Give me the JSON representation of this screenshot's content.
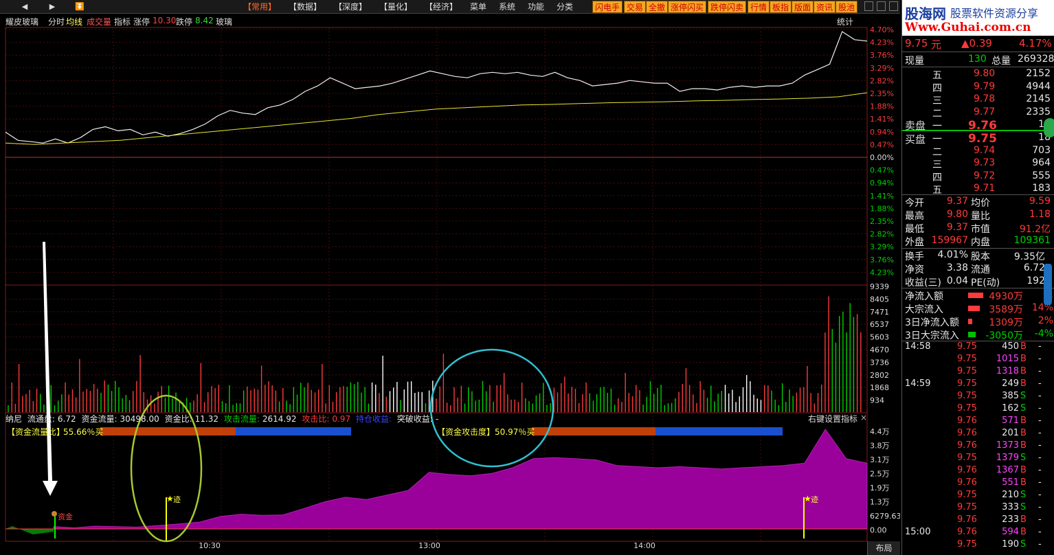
{
  "toolbar": {
    "nav": [
      "◀",
      "▶",
      "⏬"
    ],
    "menus": [
      "【常用】",
      "【数据】",
      "【深度】",
      "【量化】",
      "【经济】",
      "菜单",
      "系统",
      "功能",
      "分类"
    ],
    "active_menu": 0,
    "quick_buttons": [
      "闪电手",
      "交易",
      "全撤",
      "涨停闪买",
      "跌停闪卖",
      "行情",
      "板指",
      "版面",
      "资讯",
      "股池"
    ]
  },
  "title_row": {
    "stock_name": "耀皮玻璃",
    "view": "分时",
    "avg_line": "均线",
    "volume": "成交量",
    "indicator": "指标",
    "limit_up_label": "涨停",
    "limit_up": "10.30",
    "limit_down_label": "跌停",
    "limit_down": "8.42",
    "sector": "玻璃",
    "stats": "统计"
  },
  "chart_data": {
    "type": "line",
    "price_axis_pct": [
      "4.70%",
      "4.23%",
      "3.76%",
      "3.29%",
      "2.82%",
      "2.35%",
      "1.88%",
      "1.41%",
      "0.94%",
      "0.47%",
      "0.00%",
      "0.47%",
      "0.94%",
      "1.41%",
      "1.88%",
      "2.35%",
      "2.82%",
      "3.29%",
      "3.76%",
      "4.23%"
    ],
    "volume_axis": [
      "9339",
      "8405",
      "7471",
      "6537",
      "5603",
      "4670",
      "3736",
      "2802",
      "1868",
      "934"
    ],
    "fund_axis": [
      "4.4万",
      "3.8万",
      "3.1万",
      "2.5万",
      "1.9万",
      "1.3万",
      "6279.63",
      "0.00"
    ],
    "time_labels": [
      "10:30",
      "13:00",
      "14:00"
    ],
    "price_pct_series": [
      0.9,
      0.6,
      0.55,
      0.5,
      0.65,
      0.5,
      0.7,
      1.0,
      1.1,
      0.95,
      1.0,
      0.8,
      0.9,
      0.75,
      0.85,
      1.0,
      1.2,
      1.5,
      1.7,
      1.6,
      1.55,
      1.8,
      1.9,
      2.1,
      2.4,
      2.6,
      2.9,
      2.7,
      2.5,
      2.55,
      2.6,
      2.7,
      2.85,
      3.0,
      3.15,
      3.05,
      2.95,
      2.9,
      3.05,
      3.1,
      3.05,
      3.1,
      3.0,
      2.95,
      3.1,
      2.9,
      2.8,
      2.6,
      2.65,
      2.7,
      2.8,
      2.75,
      2.7,
      2.7,
      2.4,
      2.5,
      2.5,
      2.45,
      2.55,
      2.6,
      2.55,
      2.6,
      2.6,
      2.7,
      3.0,
      3.2,
      3.4,
      4.6,
      4.3,
      4.25
    ],
    "avg_pct_series": [
      0.5,
      0.45,
      0.5,
      0.55,
      0.6,
      0.7,
      0.8,
      0.9,
      1.0,
      1.1,
      1.2,
      1.3,
      1.4,
      1.55,
      1.65,
      1.75,
      1.8,
      1.85,
      1.9,
      1.92,
      1.95,
      1.98,
      2.0,
      2.02,
      2.05,
      2.07,
      2.1,
      2.12,
      2.15,
      2.2,
      2.35
    ],
    "fund_flow_series": [
      1000,
      500,
      1200,
      1000,
      800,
      1500,
      2200,
      3000,
      5500,
      6500,
      6000,
      6200,
      9000,
      12000,
      14000,
      13000,
      15000,
      17000,
      25000,
      24000,
      23500,
      24500,
      27000,
      31000,
      31500,
      31000,
      30500,
      28000,
      27500,
      27000,
      27500,
      27000,
      26500,
      27000,
      27500,
      28000,
      29000,
      44000,
      31000,
      29000
    ]
  },
  "indicator": {
    "name": "纳尼",
    "float_label": "流通盘:",
    "float_value": "6.72",
    "flow_label": "资金流量:",
    "flow_value": "30498.00",
    "ratio_label": "资金比:",
    "ratio_value": "11.32",
    "attack_label": "攻击流量:",
    "attack_value": "2614.92",
    "attack_ratio_label": "攻击比:",
    "attack_ratio_value": "0.97",
    "hold_label": "持仓收益:",
    "break_label": "突破收益:",
    "break_value": "-",
    "settings": "右键设置指标",
    "fund_flow_title": "【资金流量比】",
    "fund_flow_pct": "55.66％买",
    "fund_attack_title": "【资金攻击度】",
    "fund_attack_pct": "50.97％买",
    "marker_a": "迹",
    "marker_b": "迹",
    "marker_c": "资金"
  },
  "bottom_tab": "布局",
  "quote": {
    "logo_name": "股海网",
    "logo_slogan": "股票软件资源分享",
    "logo_url": "Www.Guhai.com.cn",
    "price": "9.75",
    "unit": "元",
    "change": "▲0.39",
    "change_pct": "4.17%",
    "cur_vol_label": "现量",
    "cur_vol": "130",
    "total_vol_label": "总量",
    "total_vol": "269328",
    "sell_label": "卖盘",
    "buy_label": "买盘",
    "asks": [
      {
        "level": "五",
        "price": "9.80",
        "vol": "2152"
      },
      {
        "level": "四",
        "price": "9.79",
        "vol": "4944"
      },
      {
        "level": "三",
        "price": "9.78",
        "vol": "2145"
      },
      {
        "level": "二",
        "price": "9.77",
        "vol": "2335"
      },
      {
        "level": "一",
        "price": "9.76",
        "vol": "10"
      }
    ],
    "bids": [
      {
        "level": "一",
        "price": "9.75",
        "vol": "18"
      },
      {
        "level": "二",
        "price": "9.74",
        "vol": "703"
      },
      {
        "level": "三",
        "price": "9.73",
        "vol": "964"
      },
      {
        "level": "四",
        "price": "9.72",
        "vol": "555"
      },
      {
        "level": "五",
        "price": "9.71",
        "vol": "183"
      }
    ],
    "stats": [
      {
        "l1": "今开",
        "v1": "9.37",
        "l2": "均价",
        "v2": "9.59"
      },
      {
        "l1": "最高",
        "v1": "9.80",
        "l2": "量比",
        "v2": "1.18"
      },
      {
        "l1": "最低",
        "v1": "9.37",
        "l2": "市值",
        "v2": "91.2亿"
      },
      {
        "l1": "外盘",
        "v1": "159967",
        "l2": "内盘",
        "v2": "109361"
      }
    ],
    "stats2": [
      {
        "l1": "换手",
        "v1": "4.01%",
        "l2": "股本",
        "v2": "9.35亿"
      },
      {
        "l1": "净资",
        "v1": "3.38",
        "l2": "流通",
        "v2": "6.72"
      },
      {
        "l1": "收益(三)",
        "v1": "0.04",
        "l2": "PE(动)",
        "v2": "192"
      }
    ],
    "flows": [
      {
        "label": "净流入额",
        "value": "4930万",
        "pct": "1"
      },
      {
        "label": "大宗流入",
        "value": "3589万",
        "pct": "14%"
      },
      {
        "label": "3日净流入额",
        "value": "1309万",
        "pct": "2%"
      },
      {
        "label": "3日大宗流入",
        "value": "-3050万",
        "pct": "-4%"
      }
    ],
    "ticks": [
      {
        "time": "14:58",
        "price": "9.75",
        "vol": "450",
        "side": "B"
      },
      {
        "time": "",
        "price": "9.75",
        "vol": "1015",
        "side": "B"
      },
      {
        "time": "",
        "price": "9.75",
        "vol": "1318",
        "side": "B"
      },
      {
        "time": "14:59",
        "price": "9.75",
        "vol": "249",
        "side": "B"
      },
      {
        "time": "",
        "price": "9.75",
        "vol": "385",
        "side": "S"
      },
      {
        "time": "",
        "price": "9.75",
        "vol": "162",
        "side": "S"
      },
      {
        "time": "",
        "price": "9.76",
        "vol": "571",
        "side": "B"
      },
      {
        "time": "",
        "price": "9.76",
        "vol": "201",
        "side": "B"
      },
      {
        "time": "",
        "price": "9.76",
        "vol": "1373",
        "side": "B"
      },
      {
        "time": "",
        "price": "9.75",
        "vol": "1379",
        "side": "S"
      },
      {
        "time": "",
        "price": "9.76",
        "vol": "1367",
        "side": "B"
      },
      {
        "time": "",
        "price": "9.76",
        "vol": "551",
        "side": "B"
      },
      {
        "time": "",
        "price": "9.75",
        "vol": "210",
        "side": "S"
      },
      {
        "time": "",
        "price": "9.75",
        "vol": "333",
        "side": "S"
      },
      {
        "time": "",
        "price": "9.76",
        "vol": "233",
        "side": "B"
      },
      {
        "time": "15:00",
        "price": "9.76",
        "vol": "594",
        "side": "B"
      },
      {
        "time": "",
        "price": "9.75",
        "vol": "190",
        "side": "S"
      }
    ]
  },
  "colors": {
    "up": "#ff3b3b",
    "down": "#00d200",
    "fund_fill": "#9a009a",
    "avg_line": "#e8e830"
  }
}
